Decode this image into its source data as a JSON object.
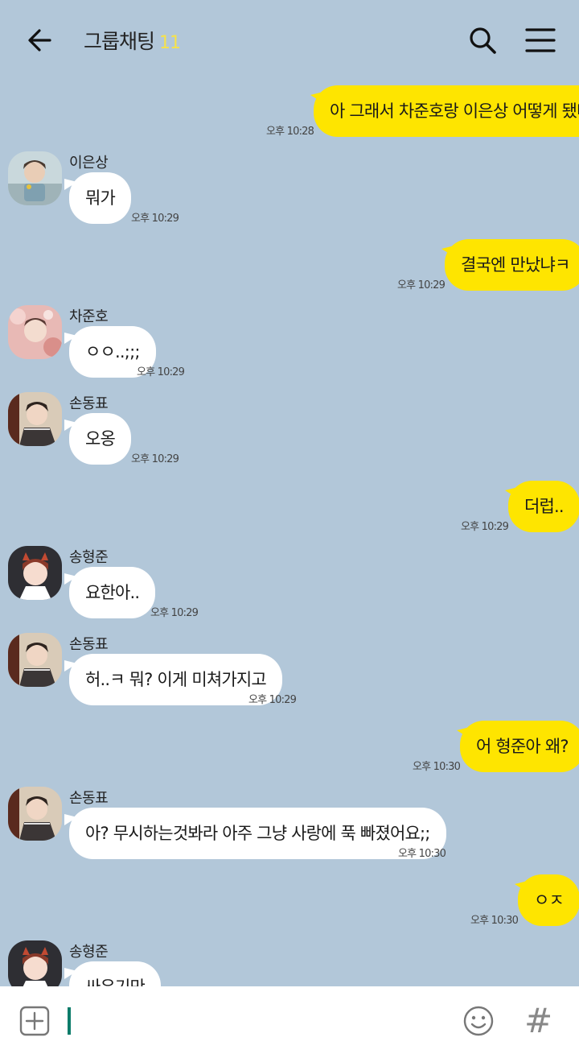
{
  "header": {
    "title": "그룹채팅",
    "member_count": "11"
  },
  "messages": [
    {
      "dir": "out",
      "text": "아 그래서 차준호랑 이은상 어떻게 됐냐",
      "time": "오후 10:28"
    },
    {
      "dir": "in",
      "sender": "이은상",
      "avatar": "avatar-eunsang",
      "text": "뭐가",
      "time": "오후 10:29"
    },
    {
      "dir": "out",
      "text": "결국엔 만났냐ㅋ",
      "time": "오후 10:29"
    },
    {
      "dir": "in",
      "sender": "차준호",
      "avatar": "avatar-junho",
      "text": "ㅇㅇ..;;;",
      "time": "오후 10:29"
    },
    {
      "dir": "in",
      "sender": "손동표",
      "avatar": "avatar-dongpyo",
      "text": "오옹",
      "time": "오후 10:29"
    },
    {
      "dir": "out",
      "text": "더럽..",
      "time": "오후 10:29"
    },
    {
      "dir": "in",
      "sender": "송형준",
      "avatar": "avatar-hyeongjun",
      "text": "요한아..",
      "time": "오후 10:29"
    },
    {
      "dir": "in",
      "sender": "손동표",
      "avatar": "avatar-dongpyo",
      "text": "허..ㅋ 뭐? 이게 미쳐가지고",
      "time": "오후 10:29"
    },
    {
      "dir": "out",
      "text": "어 형준아 왜?",
      "time": "오후 10:30"
    },
    {
      "dir": "in",
      "sender": "손동표",
      "avatar": "avatar-dongpyo",
      "text": "아? 무시하는것봐라 아주 그냥 사랑에 푹 빠졌어요;;",
      "time": "오후 10:30"
    },
    {
      "dir": "out",
      "text": "ㅇㅈ",
      "time": "오후 10:30"
    },
    {
      "dir": "in",
      "sender": "송형준",
      "avatar": "avatar-hyeongjun",
      "text": "싸우기만",
      "time": ""
    }
  ],
  "icons": {
    "back": "arrow-left-icon",
    "search": "search-icon",
    "menu": "hamburger-icon",
    "attach": "plus-square-icon",
    "emoji": "smiley-icon",
    "hashtag": "hashtag-icon"
  },
  "colors": {
    "background": "#b2c7d9",
    "outgoing_bubble": "#fee500",
    "incoming_bubble": "#ffffff",
    "count": "#f6e24b",
    "cursor": "#0c7c6a"
  },
  "input": {
    "hashtag_glyph": "#"
  }
}
